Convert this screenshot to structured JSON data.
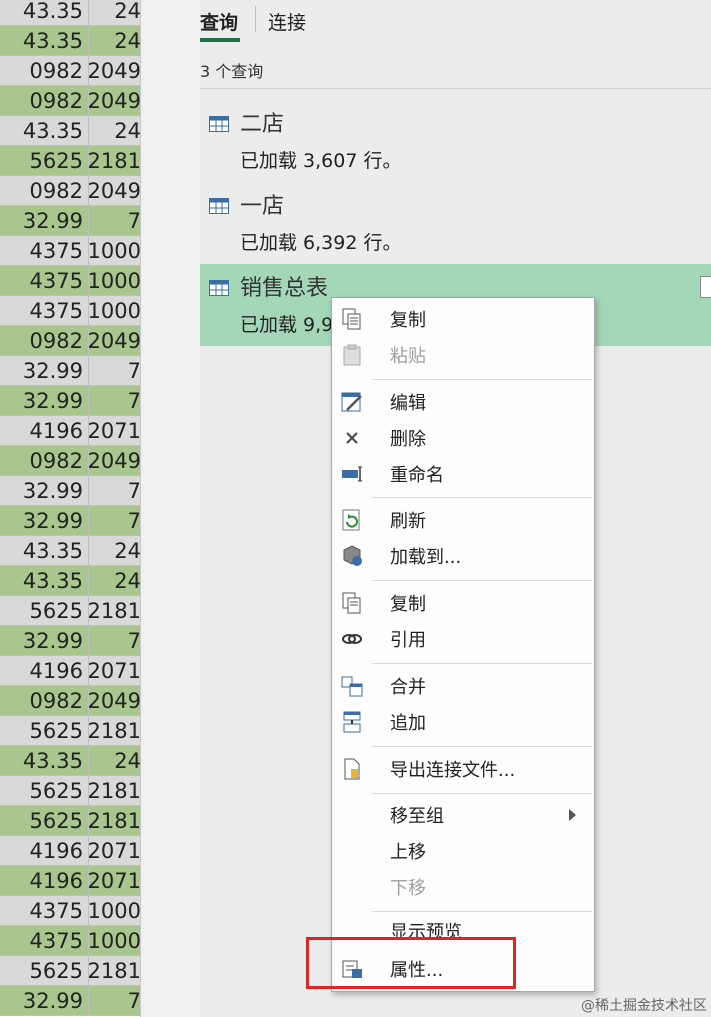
{
  "sheet": {
    "rows": [
      {
        "a": "43.35",
        "b": "24",
        "shade": "w"
      },
      {
        "a": "43.35",
        "b": "24",
        "shade": "g"
      },
      {
        "a": "0982",
        "b": "2049",
        "shade": "w"
      },
      {
        "a": "0982",
        "b": "2049",
        "shade": "g"
      },
      {
        "a": "43.35",
        "b": "24",
        "shade": "w"
      },
      {
        "a": "5625",
        "b": "2181",
        "shade": "g"
      },
      {
        "a": "0982",
        "b": "2049",
        "shade": "w"
      },
      {
        "a": "32.99",
        "b": "7",
        "shade": "g"
      },
      {
        "a": "4375",
        "b": "1000",
        "shade": "w"
      },
      {
        "a": "4375",
        "b": "1000",
        "shade": "g"
      },
      {
        "a": "4375",
        "b": "1000",
        "shade": "w"
      },
      {
        "a": "0982",
        "b": "2049",
        "shade": "g"
      },
      {
        "a": "32.99",
        "b": "7",
        "shade": "w"
      },
      {
        "a": "32.99",
        "b": "7",
        "shade": "g"
      },
      {
        "a": "4196",
        "b": "2071",
        "shade": "w"
      },
      {
        "a": "0982",
        "b": "2049",
        "shade": "g"
      },
      {
        "a": "32.99",
        "b": "7",
        "shade": "w"
      },
      {
        "a": "32.99",
        "b": "7",
        "shade": "g"
      },
      {
        "a": "43.35",
        "b": "24",
        "shade": "w"
      },
      {
        "a": "43.35",
        "b": "24",
        "shade": "g"
      },
      {
        "a": "5625",
        "b": "2181",
        "shade": "w"
      },
      {
        "a": "32.99",
        "b": "7",
        "shade": "g"
      },
      {
        "a": "4196",
        "b": "2071",
        "shade": "w"
      },
      {
        "a": "0982",
        "b": "2049",
        "shade": "g"
      },
      {
        "a": "5625",
        "b": "2181",
        "shade": "w"
      },
      {
        "a": "43.35",
        "b": "24",
        "shade": "g"
      },
      {
        "a": "5625",
        "b": "2181",
        "shade": "w"
      },
      {
        "a": "5625",
        "b": "2181",
        "shade": "g"
      },
      {
        "a": "4196",
        "b": "2071",
        "shade": "w"
      },
      {
        "a": "4196",
        "b": "2071",
        "shade": "g"
      },
      {
        "a": "4375",
        "b": "1000",
        "shade": "w"
      },
      {
        "a": "4375",
        "b": "1000",
        "shade": "g"
      },
      {
        "a": "5625",
        "b": "2181",
        "shade": "w"
      },
      {
        "a": "32.99",
        "b": "7",
        "shade": "g"
      }
    ]
  },
  "pane": {
    "tabs": {
      "query": "查询",
      "connection": "连接"
    },
    "count_label": "3 个查询",
    "queries": [
      {
        "name": "二店",
        "status": "已加载 3,607 行。"
      },
      {
        "name": "一店",
        "status": "已加载 6,392 行。"
      },
      {
        "name": "销售总表",
        "status": "已加载 9,9"
      }
    ]
  },
  "menu": {
    "copy": "复制",
    "paste": "粘贴",
    "edit": "编辑",
    "delete": "删除",
    "rename": "重命名",
    "refresh": "刷新",
    "load_to": "加载到...",
    "duplicate": "复制",
    "reference": "引用",
    "merge": "合并",
    "append": "追加",
    "export": "导出连接文件...",
    "move_to_group": "移至组",
    "move_up": "上移",
    "move_down": "下移",
    "show_preview": "显示预览",
    "properties": "属性..."
  },
  "watermark": "@稀土掘金技术社区",
  "colors": {
    "accent": "#217346",
    "selected_bg": "#a4d7b7",
    "highlight": "#e02424"
  }
}
